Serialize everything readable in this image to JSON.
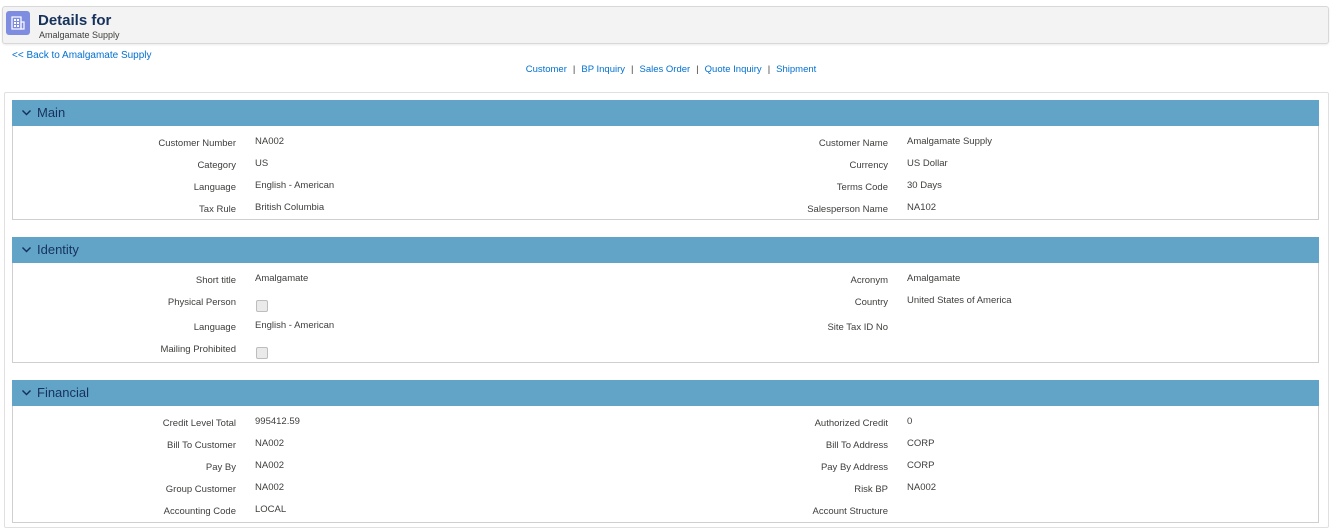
{
  "header": {
    "title": "Details for",
    "subtitle": "Amalgamate Supply",
    "icon": "building-grid-icon"
  },
  "back_link": "<< Back to Amalgamate Supply",
  "nav": {
    "links": [
      "Customer",
      "BP Inquiry",
      "Sales Order",
      "Quote Inquiry",
      "Shipment"
    ],
    "separator": "|"
  },
  "colors": {
    "section_header": "#62a4c8",
    "link": "#0070d2",
    "icon_bg": "#7f8de1"
  },
  "sections": {
    "main": {
      "title": "Main",
      "rows": [
        {
          "left_label": "Customer Number",
          "left_value": "NA002",
          "right_label": "Customer Name",
          "right_value": "Amalgamate Supply"
        },
        {
          "left_label": "Category",
          "left_value": "US",
          "right_label": "Currency",
          "right_value": "US Dollar"
        },
        {
          "left_label": "Language",
          "left_value": "English - American",
          "right_label": "Terms Code",
          "right_value": "30 Days"
        },
        {
          "left_label": "Tax Rule",
          "left_value": "British Columbia",
          "right_label": "Salesperson Name",
          "right_value": "NA102"
        }
      ]
    },
    "identity": {
      "title": "Identity",
      "rows": [
        {
          "left_label": "Short title",
          "left_value": "Amalgamate",
          "right_label": "Acronym",
          "right_value": "Amalgamate"
        },
        {
          "left_label": "Physical Person",
          "left_checked": false,
          "right_label": "Country",
          "right_value": "United States of America"
        },
        {
          "left_label": "Language",
          "left_value": "English - American",
          "right_label": "Site Tax ID No",
          "right_value": ""
        },
        {
          "left_label": "Mailing Prohibited",
          "left_checked": false
        }
      ]
    },
    "financial": {
      "title": "Financial",
      "rows": [
        {
          "left_label": "Credit Level Total",
          "left_value": "995412.59",
          "right_label": "Authorized Credit",
          "right_value": "0"
        },
        {
          "left_label": "Bill To Customer",
          "left_value": "NA002",
          "right_label": "Bill To Address",
          "right_value": "CORP"
        },
        {
          "left_label": "Pay By",
          "left_value": "NA002",
          "right_label": "Pay By Address",
          "right_value": "CORP"
        },
        {
          "left_label": "Group Customer",
          "left_value": "NA002",
          "right_label": "Risk BP",
          "right_value": "NA002"
        },
        {
          "left_label": "Accounting Code",
          "left_value": "LOCAL",
          "right_label": "Account Structure",
          "right_value": ""
        }
      ]
    }
  }
}
